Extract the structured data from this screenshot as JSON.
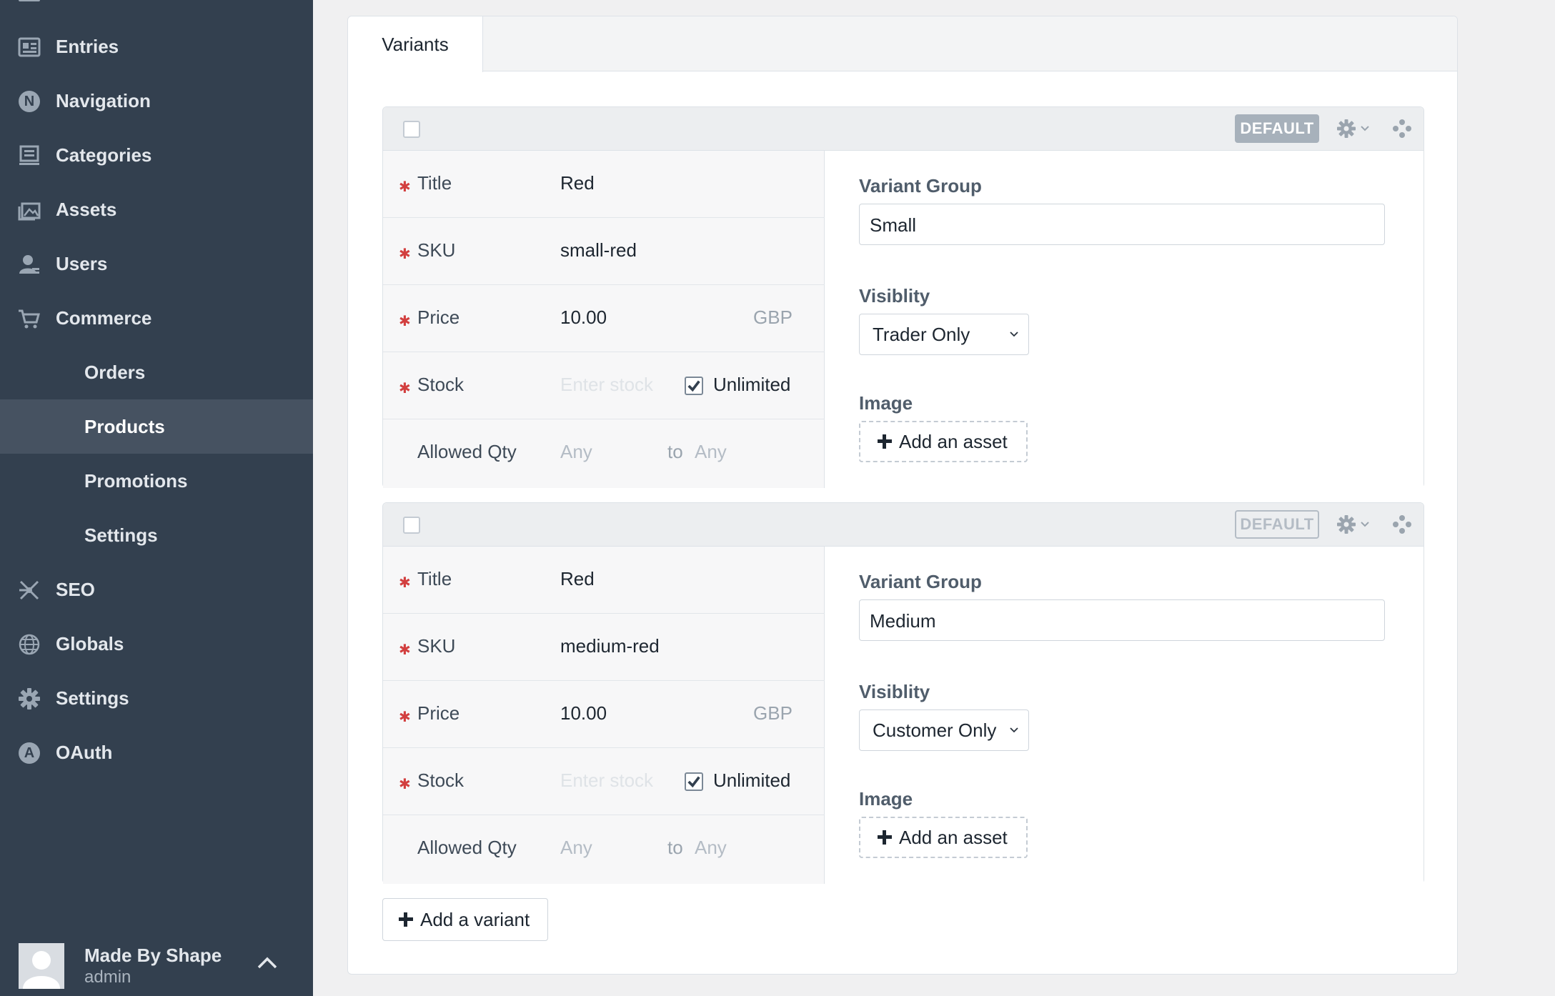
{
  "sidebar": {
    "items": [
      {
        "label": "Entries",
        "icon": "entries-icon"
      },
      {
        "label": "Navigation",
        "icon": "navigation-icon"
      },
      {
        "label": "Categories",
        "icon": "categories-icon"
      },
      {
        "label": "Assets",
        "icon": "assets-icon"
      },
      {
        "label": "Users",
        "icon": "users-icon"
      },
      {
        "label": "Commerce",
        "icon": "cart-icon"
      },
      {
        "label": "Orders"
      },
      {
        "label": "Products",
        "active": true
      },
      {
        "label": "Promotions"
      },
      {
        "label": "Settings"
      },
      {
        "label": "SEO",
        "icon": "seo-icon"
      },
      {
        "label": "Globals",
        "icon": "globe-icon"
      },
      {
        "label": "Settings",
        "icon": "gear-icon"
      },
      {
        "label": "OAuth",
        "icon": "oauth-icon"
      }
    ],
    "navigation_letter": "N",
    "oauth_letter": "A",
    "user": {
      "name": "Made By Shape",
      "role": "admin"
    }
  },
  "tabs": [
    {
      "label": "Variants",
      "active": true
    }
  ],
  "variants": [
    {
      "badge": "DEFAULT",
      "badge_active": true,
      "title_label": "Title",
      "title": "Red",
      "sku_label": "SKU",
      "sku": "small-red",
      "price_label": "Price",
      "price": "10.00",
      "currency": "GBP",
      "stock_label": "Stock",
      "stock_placeholder": "Enter stock",
      "unlimited_label": "Unlimited",
      "unlimited_checked": true,
      "qty_label": "Allowed Qty",
      "qty_min_placeholder": "Any",
      "qty_to": "to",
      "qty_max_placeholder": "Any",
      "group_label": "Variant Group",
      "group_value": "Small",
      "visibility_label": "Visiblity",
      "visibility_value": "Trader Only",
      "image_label": "Image",
      "add_asset_label": "Add an asset"
    },
    {
      "badge": "DEFAULT",
      "badge_active": false,
      "title_label": "Title",
      "title": "Red",
      "sku_label": "SKU",
      "sku": "medium-red",
      "price_label": "Price",
      "price": "10.00",
      "currency": "GBP",
      "stock_label": "Stock",
      "stock_placeholder": "Enter stock",
      "unlimited_label": "Unlimited",
      "unlimited_checked": true,
      "qty_label": "Allowed Qty",
      "qty_min_placeholder": "Any",
      "qty_to": "to",
      "qty_max_placeholder": "Any",
      "group_label": "Variant Group",
      "group_value": "Medium",
      "visibility_label": "Visiblity",
      "visibility_value": "Customer Only",
      "image_label": "Image",
      "add_asset_label": "Add an asset"
    }
  ],
  "add_variant_label": "Add a variant",
  "colors": {
    "sidebar": "#33404f",
    "sidebar_active": "#465261",
    "required": "#d23f3f"
  }
}
